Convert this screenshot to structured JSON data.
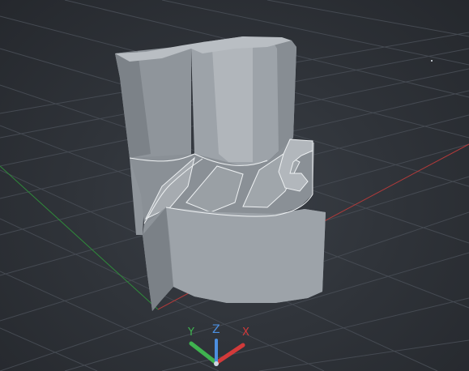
{
  "viewport": {
    "background_color": "#2b2f35",
    "grid_color": "#4a4f57",
    "model_color": "#9aa0a6",
    "edge_color": "#e9ecef"
  },
  "axis_gizmo": {
    "x_label": "X",
    "y_label": "Y",
    "z_label": "Z",
    "x_color": "#d23a3a",
    "y_color": "#3fb34f",
    "z_color": "#4c8fe0"
  },
  "world_axes": {
    "x_color": "#b03a3a",
    "y_color": "#2f8a3a"
  }
}
